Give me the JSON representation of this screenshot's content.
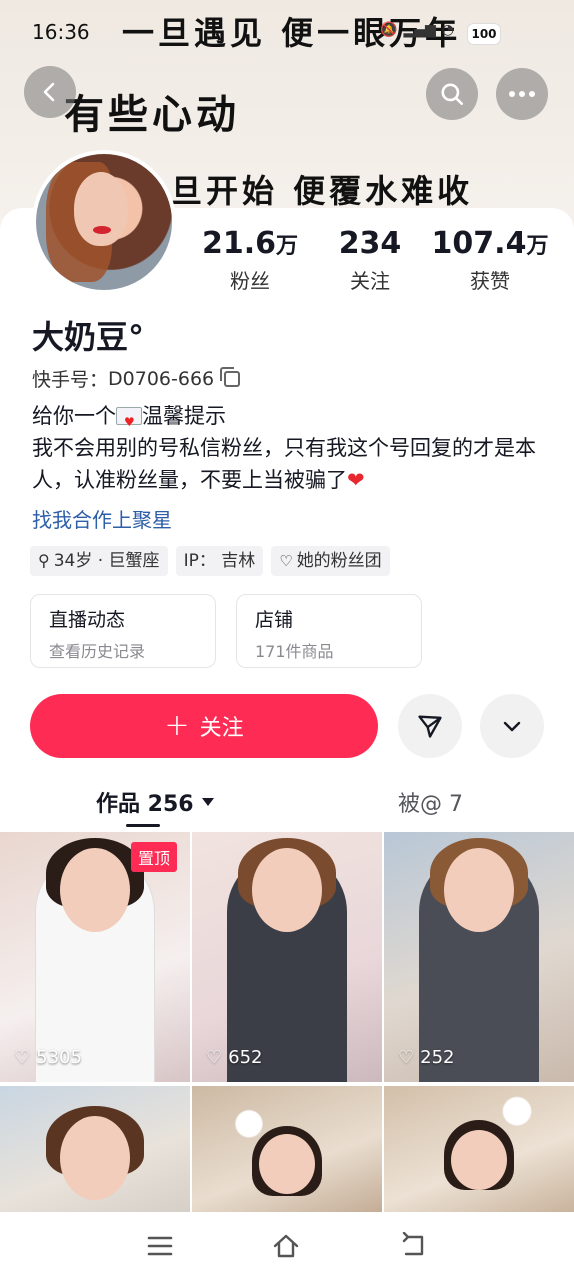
{
  "status_bar": {
    "time": "16:36",
    "battery": "100"
  },
  "banner": {
    "line1": "一旦遇见  便一眼万年",
    "line2": "有些心动",
    "line3": "旦开始  便覆水难收"
  },
  "profile": {
    "name": "大奶豆°",
    "kuaishou_id_label": "快手号：",
    "kuaishou_id": "D0706-666",
    "bio_line1": "给你一个",
    "bio_line1b": "温馨提示",
    "bio_line2": "我不会用别的号私信粉丝，只有我这个号回复的才是本人，认准粉丝量，不要上当被骗了",
    "cooperation_link": "找我合作上聚星"
  },
  "stats": [
    {
      "number": "21.6",
      "unit": "万",
      "label": "粉丝"
    },
    {
      "number": "234",
      "unit": "",
      "label": "关注"
    },
    {
      "number": "107.4",
      "unit": "万",
      "label": "获赞"
    }
  ],
  "tags": [
    {
      "icon": "gender-female-icon",
      "text": "34岁 · 巨蟹座"
    },
    {
      "icon": "",
      "text": "IP： 吉林"
    },
    {
      "icon": "heart-outline-icon",
      "text": "她的粉丝团"
    }
  ],
  "entries": [
    {
      "title": "直播动态",
      "subtitle": "查看历史记录"
    },
    {
      "title": "店铺",
      "subtitle": "171件商品"
    }
  ],
  "actions": {
    "follow_label": "关注"
  },
  "tabs": {
    "works_label": "作品 256",
    "mentioned_label": "被@ 7"
  },
  "videos": [
    {
      "likes": "5305",
      "pinned_label": "置顶"
    },
    {
      "likes": "652"
    },
    {
      "likes": "252"
    },
    {
      "likes": ""
    },
    {
      "likes": ""
    },
    {
      "likes": ""
    }
  ],
  "colors": {
    "accent": "#fe2c55",
    "link": "#2d5ea8",
    "text": "#161823"
  }
}
